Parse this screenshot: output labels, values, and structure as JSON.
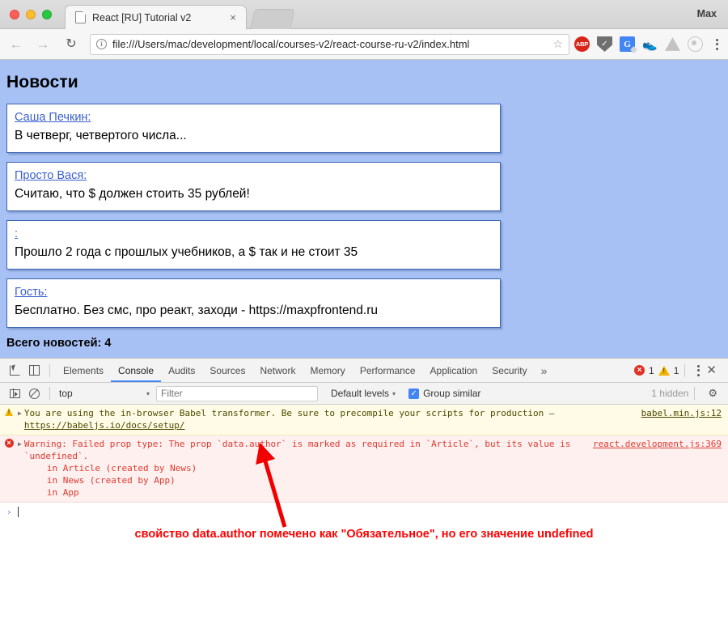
{
  "browser": {
    "traffic_lights": [
      "close",
      "minimize",
      "maximize"
    ],
    "tab": {
      "title": "React [RU] Tutorial v2",
      "close_label": "×",
      "favicon": "page-icon"
    },
    "profile_name": "Max",
    "nav": {
      "back": "←",
      "forward": "→",
      "reload": "↻"
    },
    "omnibox": {
      "url": "file:///Users/mac/development/local/courses-v2/react-course-ru-v2/index.html",
      "info_icon": "i",
      "star_icon": "☆"
    },
    "extensions": [
      {
        "name": "adblock-plus-extension-icon",
        "label": "ABP"
      },
      {
        "name": "shield-extension-icon",
        "label": "✓"
      },
      {
        "name": "google-translate-extension-icon",
        "label": "G"
      },
      {
        "name": "shoe-extension-icon",
        "label": "👟"
      },
      {
        "name": "google-drive-extension-icon",
        "label": ""
      },
      {
        "name": "ring-extension-icon",
        "label": ""
      }
    ],
    "menu_icon": "kebab-menu-icon"
  },
  "page": {
    "title": "Новости",
    "background_color": "#a7c1f5",
    "card_border_color": "#3b63b5",
    "link_color": "#3a5fcd",
    "news": [
      {
        "author": "Саша Печкин:",
        "text": "В четверг, четвертого числа..."
      },
      {
        "author": "Просто Вася:",
        "text": "Считаю, что $ должен стоить 35 рублей!"
      },
      {
        "author": ":",
        "text": "Прошло 2 года с прошлых учебников, а $ так и не стоит 35"
      },
      {
        "author": "Гость:",
        "text": "Бесплатно. Без смс, про реакт, заходи - https://maxpfrontend.ru"
      }
    ],
    "total_label": "Всего новостей: 4"
  },
  "devtools": {
    "tabs": [
      {
        "label": "Elements",
        "active": false
      },
      {
        "label": "Console",
        "active": true
      },
      {
        "label": "Audits",
        "active": false
      },
      {
        "label": "Sources",
        "active": false
      },
      {
        "label": "Network",
        "active": false
      },
      {
        "label": "Memory",
        "active": false
      },
      {
        "label": "Performance",
        "active": false
      },
      {
        "label": "Application",
        "active": false
      },
      {
        "label": "Security",
        "active": false
      }
    ],
    "more_tabs_label": "»",
    "error_count": "1",
    "warning_count": "1",
    "error_badge_glyph": "×",
    "close_label": "✕",
    "filterbar": {
      "context": "top",
      "context_caret": "▾",
      "filter_placeholder": "Filter",
      "filter_value": "",
      "levels_label": "Default levels",
      "levels_caret": "▾",
      "group_similar_label": "Group similar",
      "group_similar_checked": true,
      "checkmark": "✓",
      "hidden_label": "1 hidden",
      "settings_icon": "gear-icon"
    },
    "messages": [
      {
        "type": "warning",
        "icon_glyph": "!",
        "expander": "▶",
        "text": "You are using the in-browser Babel transformer. Be sure to precompile your scripts for production – ",
        "inline_link": "https://babeljs.io/docs/setup/",
        "source": "babel.min.js:12",
        "stack": []
      },
      {
        "type": "error",
        "icon_glyph": "×",
        "expander": "▶",
        "text": "Warning: Failed prop type: The prop `data.author` is marked as required in `Article`, but its value is `undefined`.",
        "inline_link": "",
        "source": "react.development.js:369",
        "stack": [
          "in Article (created by News)",
          "in News (created by App)",
          "in App"
        ]
      }
    ],
    "prompt": {
      "caret": "›",
      "value": ""
    }
  },
  "annotation": {
    "text": "свойство data.author помечено как \"Обязательное\", но его значение undefined",
    "color": "#ff0000"
  }
}
